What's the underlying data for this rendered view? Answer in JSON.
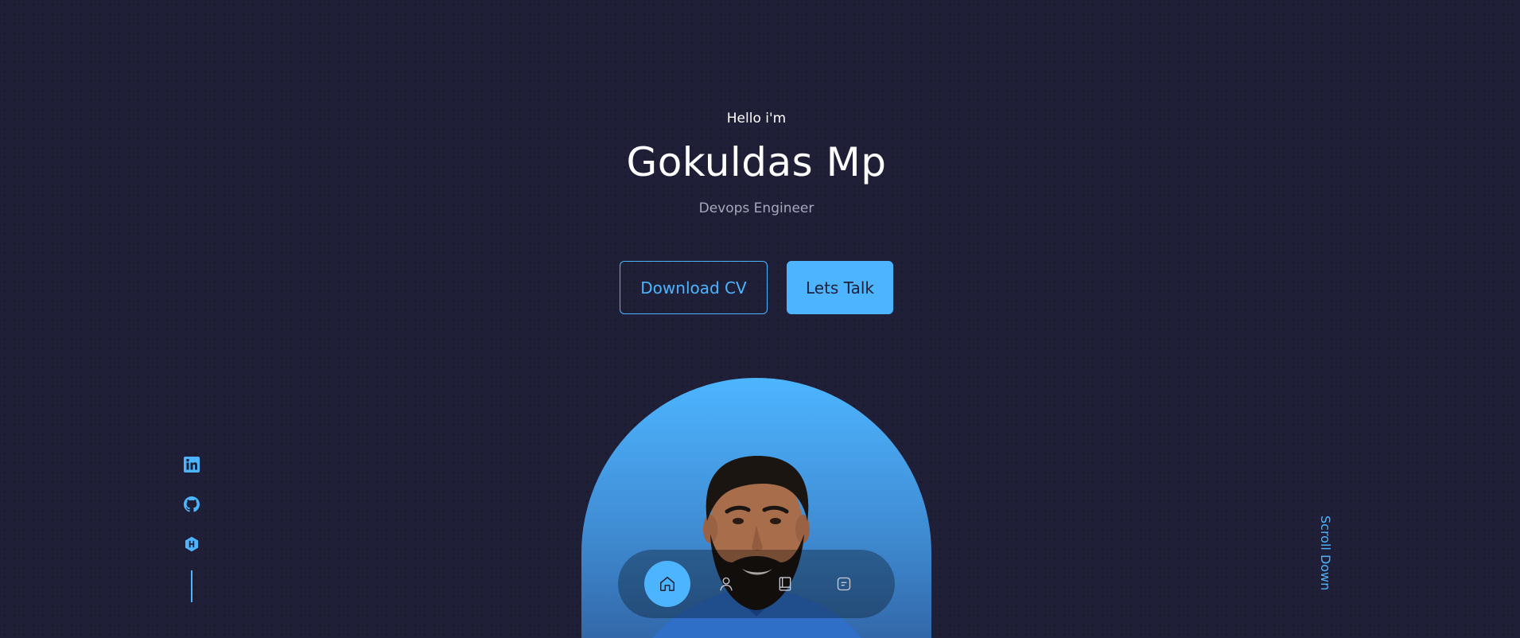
{
  "header": {
    "greeting": "Hello i'm",
    "name": "Gokuldas Mp",
    "role": "Devops Engineer"
  },
  "cta": {
    "download_label": "Download CV",
    "talk_label": "Lets Talk"
  },
  "socials": [
    {
      "icon": "linkedin-icon"
    },
    {
      "icon": "github-icon"
    },
    {
      "icon": "hashnode-icon"
    }
  ],
  "scroll": {
    "label": "Scroll Down"
  },
  "nav": {
    "items": [
      {
        "icon": "home-icon",
        "active": true
      },
      {
        "icon": "user-icon",
        "active": false
      },
      {
        "icon": "book-icon",
        "active": false
      },
      {
        "icon": "message-icon",
        "active": false
      }
    ]
  },
  "colors": {
    "background": "#1f1f38",
    "accent": "#4db5ff",
    "text_light": "#a7a7be"
  }
}
